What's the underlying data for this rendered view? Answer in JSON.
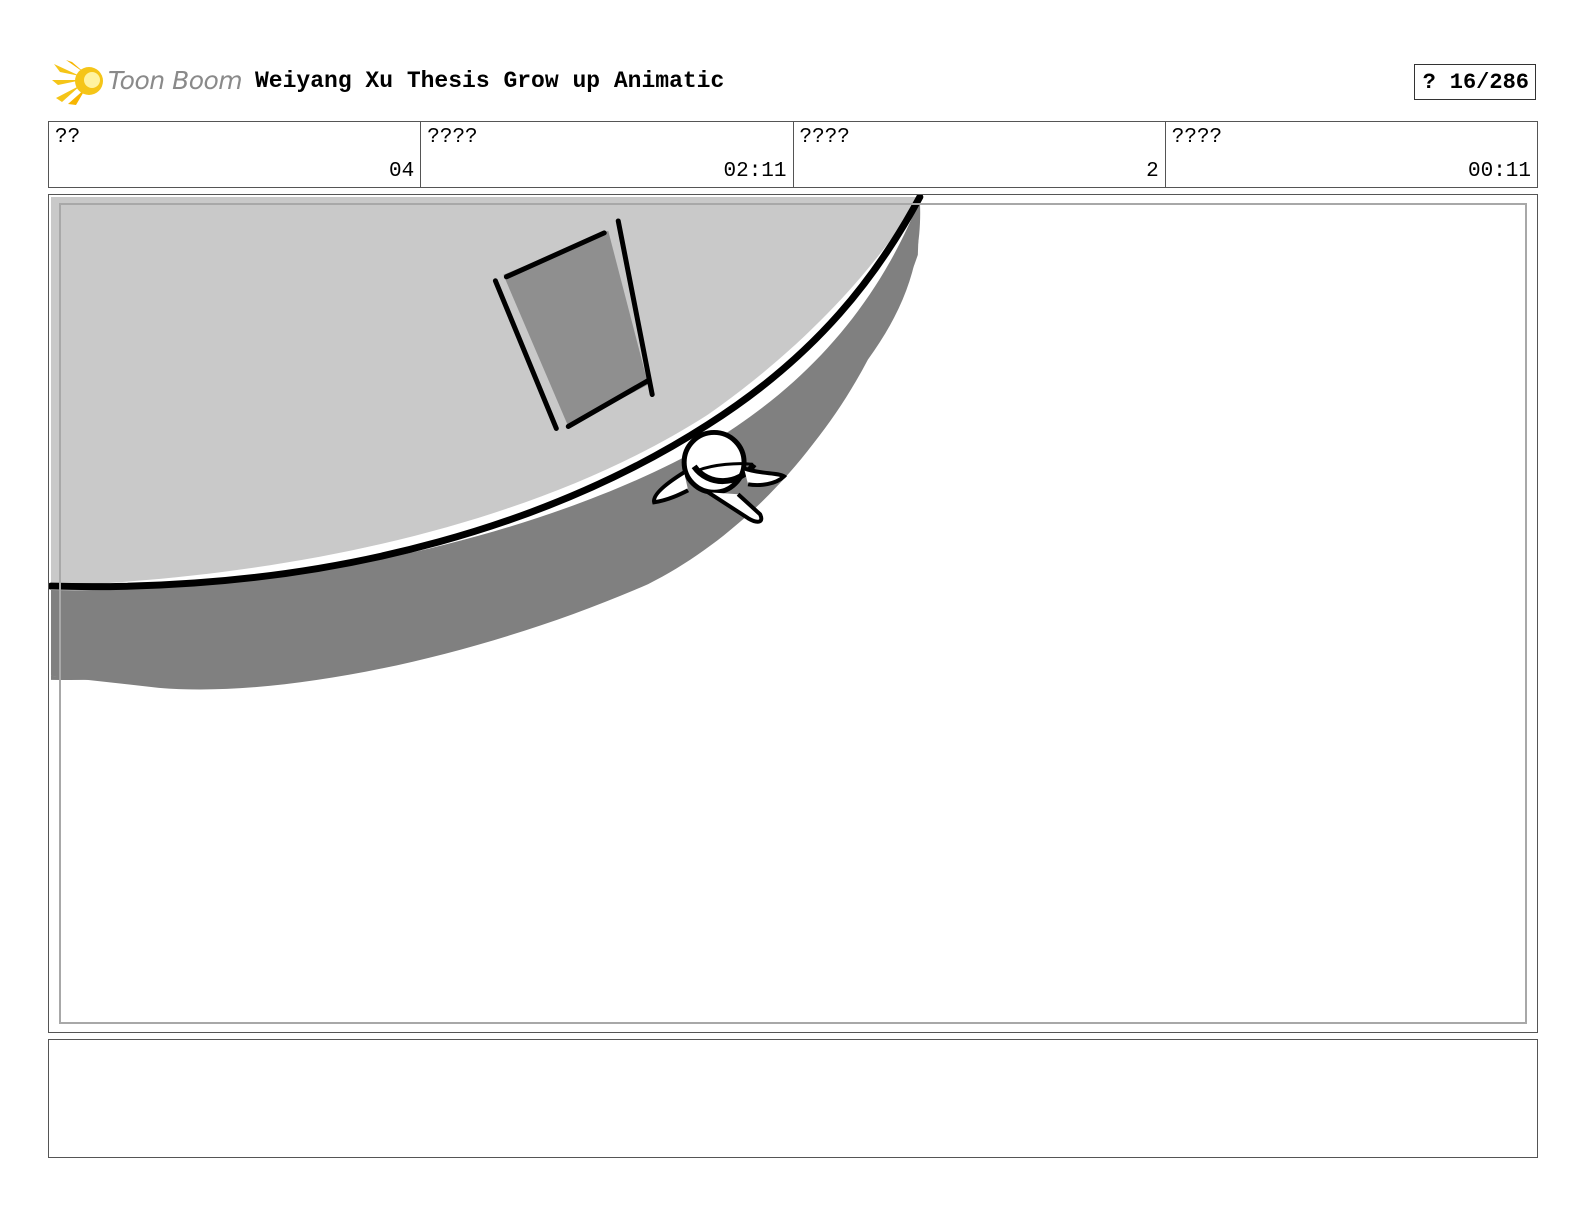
{
  "header": {
    "logo_text": "Toon Boom",
    "project_title": "Weiyang Xu Thesis Grow up Animatic",
    "page_prefix": "?",
    "page_number": "16/286"
  },
  "info": [
    {
      "label": "??",
      "value": "04"
    },
    {
      "label": "????",
      "value": "02:11"
    },
    {
      "label": "????",
      "value": "2"
    },
    {
      "label": "????",
      "value": "00:11"
    }
  ],
  "colors": {
    "logo_yellow": "#f5c518",
    "light_gray": "#c9c9c9",
    "dark_gray": "#808080",
    "line": "#000000"
  },
  "notes": {
    "text": ""
  }
}
